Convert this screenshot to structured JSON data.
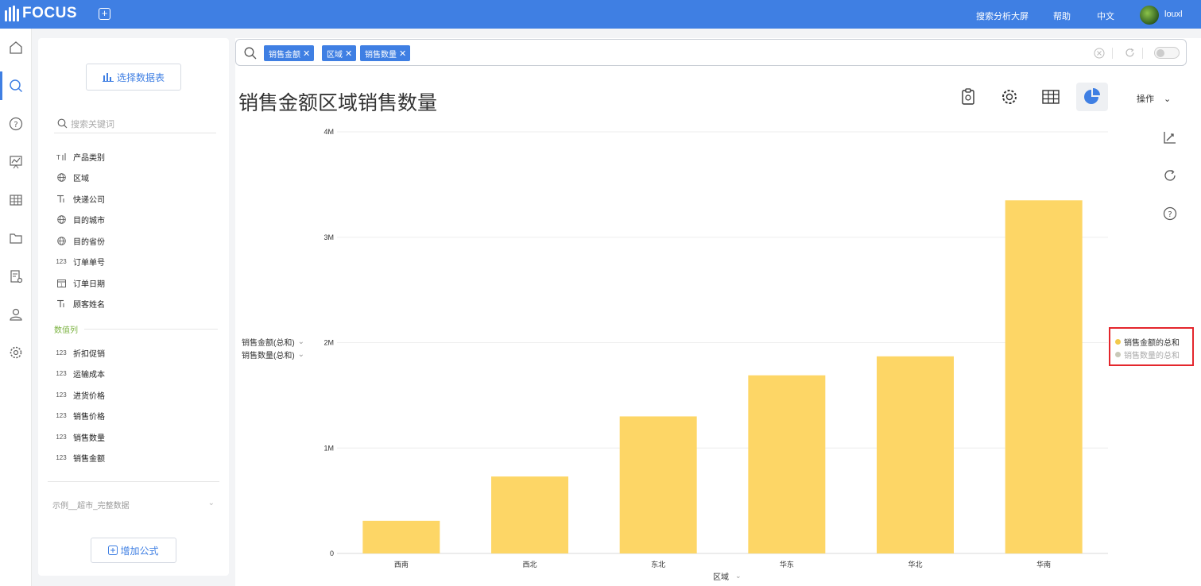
{
  "app": {
    "logo_text": "FOCUS",
    "top_links": [
      "搜索分析大屏",
      "帮助",
      "中文"
    ],
    "username": "louxl"
  },
  "rail_icons": [
    "home-icon",
    "search-icon",
    "help-icon",
    "dashboard-icon",
    "table-icon",
    "folder-icon",
    "report-settings-icon",
    "user-icon",
    "settings-icon"
  ],
  "panel": {
    "select_table_label": "选择数据表",
    "search_placeholder": "搜索关键词",
    "dimension_fields": [
      {
        "type": "attr",
        "label": "产品类别"
      },
      {
        "type": "geo",
        "label": "区域"
      },
      {
        "type": "text",
        "label": "快递公司"
      },
      {
        "type": "geo",
        "label": "目的城市"
      },
      {
        "type": "geo",
        "label": "目的省份"
      },
      {
        "type": "num",
        "label": "订单单号"
      },
      {
        "type": "date",
        "label": "订单日期"
      },
      {
        "type": "text",
        "label": "顾客姓名"
      }
    ],
    "measure_section_label": "数值列",
    "measure_fields": [
      {
        "type": "num",
        "label": "折扣促销"
      },
      {
        "type": "num",
        "label": "运输成本"
      },
      {
        "type": "num",
        "label": "进货价格"
      },
      {
        "type": "num",
        "label": "销售价格"
      },
      {
        "type": "num",
        "label": "销售数量"
      },
      {
        "type": "num",
        "label": "销售金额"
      }
    ],
    "num_type_label": "123",
    "source_label": "示例__超市_完整数据",
    "add_formula_label": "增加公式"
  },
  "search": {
    "tokens": [
      "销售金额",
      "区域",
      "销售数量"
    ]
  },
  "main": {
    "title": "销售金额区域销售数量",
    "ops_label": "操作",
    "y_measures": [
      "销售金额(总和)",
      "销售数量(总和)"
    ],
    "x_axis_label": "区域"
  },
  "legend": {
    "items": [
      {
        "label": "销售金额的总和",
        "color": "#f2c94c",
        "active": true
      },
      {
        "label": "销售数量的总和",
        "color": "#c9c9b8",
        "active": false
      }
    ]
  },
  "chart_data": {
    "type": "bar",
    "categories": [
      "西南",
      "西北",
      "东北",
      "华东",
      "华北",
      "华南"
    ],
    "series": [
      {
        "name": "销售金额的总和",
        "values": [
          310000,
          730000,
          1300000,
          1690000,
          1870000,
          3350000
        ]
      }
    ],
    "y_ticks": [
      "0",
      "1M",
      "2M",
      "3M",
      "4M"
    ],
    "ylim": [
      0,
      4000000
    ],
    "xlabel": "区域",
    "bar_color": "#fdd666",
    "grid": true
  }
}
